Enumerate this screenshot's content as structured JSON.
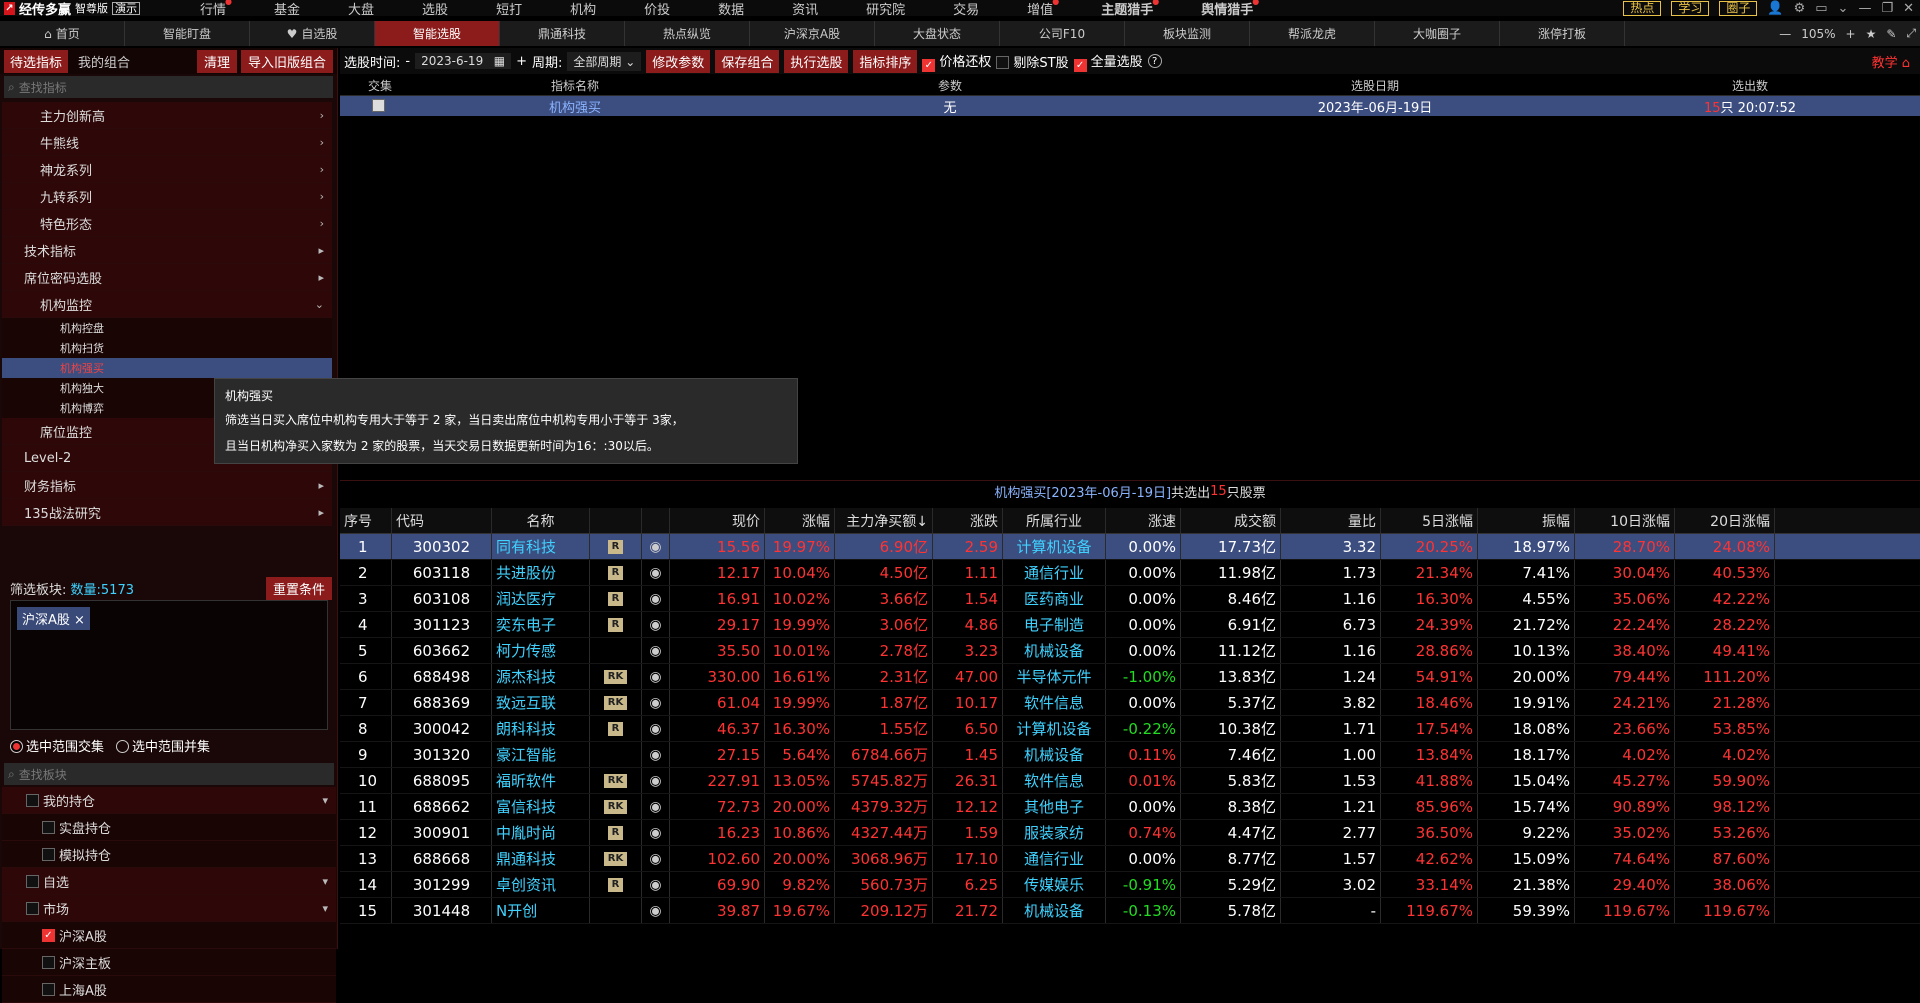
{
  "app": {
    "logo_text": "经传多赢",
    "edition": "智尊版",
    "demo": "演示"
  },
  "top_menu": [
    {
      "label": "行情",
      "hot": false,
      "dot": true
    },
    {
      "label": "基金",
      "hot": false,
      "dot": false
    },
    {
      "label": "大盘",
      "hot": false,
      "dot": false
    },
    {
      "label": "选股",
      "hot": false,
      "dot": false
    },
    {
      "label": "短打",
      "hot": false,
      "dot": false
    },
    {
      "label": "机构",
      "hot": false,
      "dot": false
    },
    {
      "label": "价投",
      "hot": false,
      "dot": false
    },
    {
      "label": "数据",
      "hot": false,
      "dot": false
    },
    {
      "label": "资讯",
      "hot": false,
      "dot": false
    },
    {
      "label": "研究院",
      "hot": false,
      "dot": false
    },
    {
      "label": "交易",
      "hot": false,
      "dot": false
    },
    {
      "label": "增值",
      "hot": false,
      "dot": true
    },
    {
      "label": "主题猎手",
      "hot": true,
      "dot": true
    },
    {
      "label": "舆情猎手",
      "hot": true,
      "dot": true
    }
  ],
  "top_right": {
    "btn1": "热点",
    "btn2": "学习",
    "btn3": "圈子",
    "zoom": "105%"
  },
  "nav_tabs": [
    {
      "label": "首页",
      "icon": "home-icon"
    },
    {
      "label": "智能盯盘",
      "icon": ""
    },
    {
      "label": "自选股",
      "icon": "heart-icon"
    },
    {
      "label": "智能选股",
      "icon": "",
      "active": true
    },
    {
      "label": "鼎通科技",
      "icon": ""
    },
    {
      "label": "热点纵览",
      "icon": ""
    },
    {
      "label": "沪深京A股",
      "icon": ""
    },
    {
      "label": "大盘状态",
      "icon": ""
    },
    {
      "label": "公司F10",
      "icon": ""
    },
    {
      "label": "板块监测",
      "icon": ""
    },
    {
      "label": "帮派龙虎",
      "icon": ""
    },
    {
      "label": "大咖圈子",
      "icon": ""
    },
    {
      "label": "涨停打板",
      "icon": ""
    }
  ],
  "left": {
    "tab_pending": "待选指标",
    "tab_mine": "我的组合",
    "btn_clear": "清理",
    "btn_import": "导入旧版组合",
    "search_placeholder": "查找指标",
    "tree": [
      {
        "label": "主力创新高",
        "level": 2
      },
      {
        "label": "牛熊线",
        "level": 2
      },
      {
        "label": "神龙系列",
        "level": 2
      },
      {
        "label": "九转系列",
        "level": 2
      },
      {
        "label": "特色形态",
        "level": 2
      },
      {
        "label": "技术指标",
        "level": 1
      },
      {
        "label": "席位密码选股",
        "level": 1
      },
      {
        "label": "机构监控",
        "level": 2,
        "open": true
      },
      {
        "label": "机构控盘",
        "level": 3
      },
      {
        "label": "机构扫货",
        "level": 3
      },
      {
        "label": "机构强买",
        "level": 3,
        "selected": true
      },
      {
        "label": "机构独大",
        "level": 3
      },
      {
        "label": "机构博弈",
        "level": 3
      },
      {
        "label": "席位监控",
        "level": 2
      },
      {
        "label": "Level-2",
        "level": 1
      },
      {
        "label": "财务指标",
        "level": 1
      },
      {
        "label": "135战法研究",
        "level": 1
      }
    ],
    "filter_label": "筛选板块:",
    "filter_count": "数量:5173",
    "reset_btn": "重置条件",
    "chip": "沪深A股",
    "radio1": "选中范围交集",
    "radio2": "选中范围并集",
    "search2_placeholder": "查找板块",
    "tree2": [
      {
        "label": "我的持仓",
        "level": 1,
        "checked": false,
        "arrow": true
      },
      {
        "label": "实盘持仓",
        "level": 2,
        "checked": false
      },
      {
        "label": "模拟持仓",
        "level": 2,
        "checked": false
      },
      {
        "label": "自选",
        "level": 1,
        "checked": false,
        "arrow": true
      },
      {
        "label": "市场",
        "level": 1,
        "checked": false,
        "arrow": true
      },
      {
        "label": "沪深A股",
        "level": 2,
        "checked": true
      },
      {
        "label": "沪深主板",
        "level": 2,
        "checked": false
      },
      {
        "label": "上海A股",
        "level": 2,
        "checked": false
      }
    ]
  },
  "toolbar": {
    "time_label": "选股时间:",
    "date": "2023-6-19",
    "period_label": "周期:",
    "period_value": "全部周期",
    "btn_modify": "修改参数",
    "btn_save": "保存组合",
    "btn_run": "执行选股",
    "btn_sort": "指标排序",
    "cb_price": "价格还权",
    "cb_st": "剔除ST股",
    "cb_all": "全量选股",
    "teach": "教学"
  },
  "indicator_table": {
    "headers": [
      "交集",
      "指标名称",
      "参数",
      "选股日期",
      "选出数"
    ],
    "row": {
      "name": "机构强买",
      "param": "无",
      "date": "2023年-06月-19日",
      "count": "15",
      "count_suffix": "只 20:07:52"
    }
  },
  "tooltip": {
    "title": "机构强买",
    "line1": "筛选当日买入席位中机构专用大于等于 2 家，当日卖出席位中机构专用小于等于 3家，",
    "line2": "且当日机构净买入家数为 2 家的股票，当天交易日数据更新时间为16：:30以后。"
  },
  "result": {
    "caption_prefix": "机构强买[2023年-06月-19日]",
    "caption_mid": " 共选出",
    "caption_count": "15",
    "caption_suffix": "只股票",
    "headers": [
      "序号",
      "代码",
      "名称",
      "",
      "",
      "现价",
      "涨幅",
      "主力净买额↓",
      "涨跌",
      "所属行业",
      "涨速",
      "成交额",
      "量比",
      "5日涨幅",
      "振幅",
      "10日涨幅",
      "20日涨幅"
    ],
    "rows": [
      [
        "1",
        "300302",
        "同有科技",
        "R",
        "15.56",
        "19.97%",
        "6.90亿",
        "2.59",
        "计算机设备",
        "0.00%",
        "17.73亿",
        "3.32",
        "20.25%",
        "18.97%",
        "28.70%",
        "24.08%"
      ],
      [
        "2",
        "603118",
        "共进股份",
        "R",
        "12.17",
        "10.04%",
        "4.50亿",
        "1.11",
        "通信行业",
        "0.00%",
        "11.98亿",
        "1.73",
        "21.34%",
        "7.41%",
        "30.04%",
        "40.53%"
      ],
      [
        "3",
        "603108",
        "润达医疗",
        "R",
        "16.91",
        "10.02%",
        "3.66亿",
        "1.54",
        "医药商业",
        "0.00%",
        "8.46亿",
        "1.16",
        "16.30%",
        "4.55%",
        "35.06%",
        "42.22%"
      ],
      [
        "4",
        "301123",
        "奕东电子",
        "R",
        "29.17",
        "19.99%",
        "3.06亿",
        "4.86",
        "电子制造",
        "0.00%",
        "6.91亿",
        "6.73",
        "24.39%",
        "21.72%",
        "22.24%",
        "28.22%"
      ],
      [
        "5",
        "603662",
        "柯力传感",
        "",
        "35.50",
        "10.01%",
        "2.78亿",
        "3.23",
        "机械设备",
        "0.00%",
        "11.12亿",
        "1.16",
        "28.86%",
        "10.13%",
        "38.40%",
        "49.41%"
      ],
      [
        "6",
        "688498",
        "源杰科技",
        "RK",
        "330.00",
        "16.61%",
        "2.31亿",
        "47.00",
        "半导体元件",
        "-1.00%",
        "13.83亿",
        "1.24",
        "54.91%",
        "20.00%",
        "79.44%",
        "111.20%"
      ],
      [
        "7",
        "688369",
        "致远互联",
        "RK",
        "61.04",
        "19.99%",
        "1.87亿",
        "10.17",
        "软件信息",
        "0.00%",
        "5.37亿",
        "3.82",
        "18.46%",
        "19.91%",
        "24.21%",
        "21.28%"
      ],
      [
        "8",
        "300042",
        "朗科科技",
        "R",
        "46.37",
        "16.30%",
        "1.55亿",
        "6.50",
        "计算机设备",
        "-0.22%",
        "10.38亿",
        "1.71",
        "17.54%",
        "18.08%",
        "23.66%",
        "53.85%"
      ],
      [
        "9",
        "301320",
        "豪江智能",
        "",
        "27.15",
        "5.64%",
        "6784.66万",
        "1.45",
        "机械设备",
        "0.11%",
        "7.46亿",
        "1.00",
        "13.84%",
        "18.17%",
        "4.02%",
        "4.02%"
      ],
      [
        "10",
        "688095",
        "福昕软件",
        "RK",
        "227.91",
        "13.05%",
        "5745.82万",
        "26.31",
        "软件信息",
        "0.01%",
        "5.83亿",
        "1.53",
        "41.88%",
        "15.04%",
        "45.27%",
        "59.90%"
      ],
      [
        "11",
        "688662",
        "富信科技",
        "RK",
        "72.73",
        "20.00%",
        "4379.32万",
        "12.12",
        "其他电子",
        "0.00%",
        "8.38亿",
        "1.21",
        "85.96%",
        "15.74%",
        "90.89%",
        "98.12%"
      ],
      [
        "12",
        "300901",
        "中胤时尚",
        "R",
        "16.23",
        "10.86%",
        "4327.44万",
        "1.59",
        "服装家纺",
        "0.74%",
        "4.47亿",
        "2.77",
        "36.50%",
        "9.22%",
        "35.02%",
        "53.26%"
      ],
      [
        "13",
        "688668",
        "鼎通科技",
        "RK",
        "102.60",
        "20.00%",
        "3068.96万",
        "17.10",
        "通信行业",
        "0.00%",
        "8.77亿",
        "1.57",
        "42.62%",
        "15.09%",
        "74.64%",
        "87.60%"
      ],
      [
        "14",
        "301299",
        "卓创资讯",
        "R",
        "69.90",
        "9.82%",
        "560.73万",
        "6.25",
        "传媒娱乐",
        "-0.91%",
        "5.29亿",
        "3.02",
        "33.14%",
        "21.38%",
        "29.40%",
        "38.06%"
      ],
      [
        "15",
        "301448",
        "N开创",
        "",
        "39.87",
        "19.67%",
        "209.12万",
        "21.72",
        "机械设备",
        "-0.13%",
        "5.78亿",
        "-",
        "119.67%",
        "59.39%",
        "119.67%",
        "119.67%"
      ]
    ]
  },
  "colors": {
    "accent": "#8c1c1c",
    "up": "#ff3333",
    "down": "#22dd22",
    "industry": "#3fd2ff",
    "selected": "#3c4d80"
  }
}
